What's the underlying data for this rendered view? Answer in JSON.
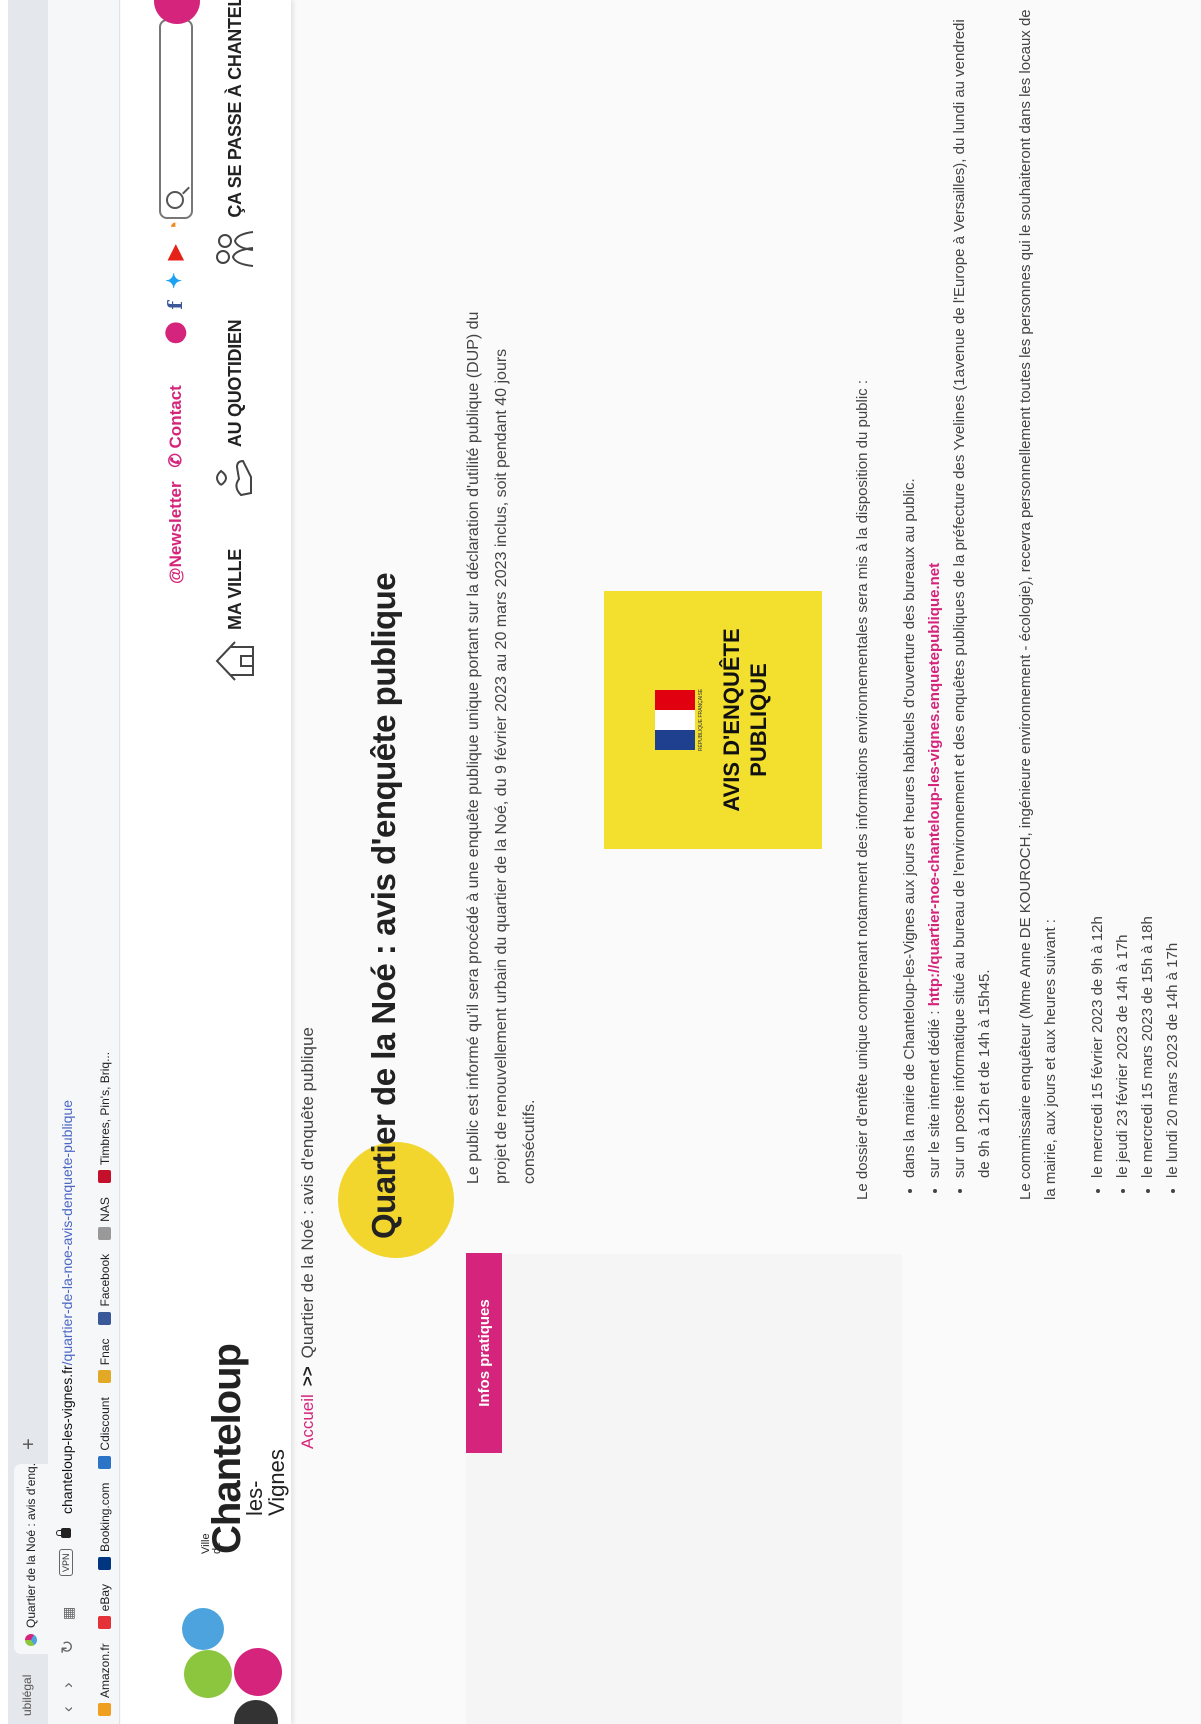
{
  "browser": {
    "prev_tab_label": "ubilégal",
    "active_tab_title": "Quartier de la Noé : avis d'enq...",
    "new_tab_symbol": "+",
    "vpn_badge": "VPN",
    "url_domain": "chanteloup-les-vignes.fr",
    "url_path": "/quartier-de-la-noe-avis-denquete-publique",
    "bookmarks": [
      {
        "label": "Amazon.fr",
        "icon": "amazon-icon",
        "color": "#f0a020"
      },
      {
        "label": "eBay",
        "icon": "ebay-icon",
        "color": "#e53238"
      },
      {
        "label": "Booking.com",
        "icon": "booking-icon",
        "color": "#003580"
      },
      {
        "label": "Cdiscount",
        "icon": "cdiscount-icon",
        "color": "#2b74c8"
      },
      {
        "label": "Fnac",
        "icon": "fnac-icon",
        "color": "#e1a925"
      },
      {
        "label": "Facebook",
        "icon": "facebook-icon",
        "color": "#3b5998"
      },
      {
        "label": "NAS",
        "icon": "synology-icon",
        "color": "#999999"
      },
      {
        "label": "Timbres, Pin's, Briq...",
        "icon": "ie-icon",
        "color": "#c4102b"
      }
    ]
  },
  "site": {
    "logo": {
      "ville": "Ville de",
      "name": "Chanteloup",
      "sub": "les-Vignes"
    },
    "newsletter": "@Newsletter",
    "contact": "Contact",
    "nav": [
      {
        "label": "MA VILLE",
        "icon": "house-icon"
      },
      {
        "label": "AU QUOTIDIEN",
        "icon": "hands-icon"
      },
      {
        "label": "ÇA SE PASSE À CHANTELOUP",
        "icon": "people-icon"
      }
    ],
    "colors": {
      "accent": "#d5247b",
      "yellow": "#f2d62e"
    }
  },
  "breadcrumb": {
    "home": "Accueil",
    "separator": ">>",
    "current": "Quartier de la Noé : avis d'enquête publique"
  },
  "sidebar": {
    "button": "Infos pratiques"
  },
  "page": {
    "title": "Quartier de la Noé : avis d'enquête publique",
    "intro": "Le public est informé qu'il sera procédé à une enquête publique unique portant sur la déclaration d'utilité publique (DUP) du projet de renouvellement urbain du quartier de la Noé, du 9 février 2023 au 20 mars 2023 inclus, soit pendant 40 jours consécutifs.",
    "notice": {
      "line1": "AVIS D'ENQUÊTE",
      "line2": "PUBLIQUE",
      "caption": "RÉPUBLIQUE FRANÇAISE"
    },
    "dossier_intro": "Le dossier d'entête unique comprenant notamment des informations environnementales sera mis à la disposition du public :",
    "dossier_items": [
      {
        "text": "dans la mairie de Chanteloup-les-Vignes aux jours et heures habituels d'ouverture des bureaux au public."
      },
      {
        "text": "sur le site internet dédié : ",
        "link": "http://quartier-noe-chanteloup-les-vignes.enquetepublique.net"
      },
      {
        "text": "sur un poste informatique situé au bureau de l'environnement et des enquêtes publiques de la préfecture des Yvelines (1avenue de l'Europe à Versailles), du lundi au vendredi de 9h à 12h et de 14h à 15h45."
      }
    ],
    "commissaire": "Le commissaire enquêteur (Mme Anne DE KOUROCH, ingénieure environnement - écologie), recevra personnellement toutes les personnes qui le souhaiteront dans les locaux de la mairie, aux jours et aux heures suivant :",
    "dates": [
      "le mercredi 15 février 2023 de 9h à 12h",
      "le jeudi 23 février 2023 de 14h à 17h",
      "le mercredi 15 mars 2023 de 15h à 18h",
      "le lundi 20 mars 2023 de 14h à 17h"
    ]
  }
}
